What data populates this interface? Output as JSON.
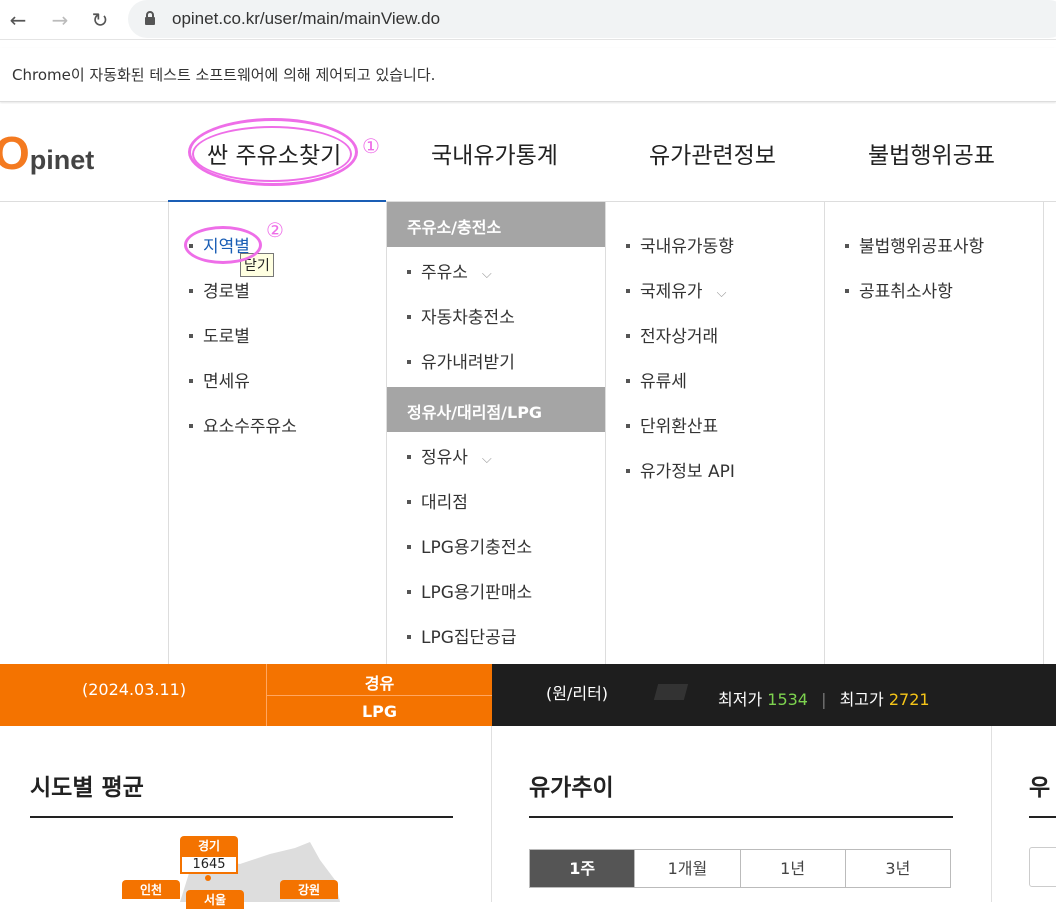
{
  "browser": {
    "url": "opinet.co.kr/user/main/mainView.do",
    "infobar_text": "Chrome이 자동화된 테스트 소프트웨어에 의해 제어되고 있습니다."
  },
  "header": {
    "logo_o": "O",
    "logo_rest": "pinet",
    "gnb": [
      "싼 주유소찾기",
      "국내유가통계",
      "유가관련정보",
      "불법행위공표"
    ]
  },
  "mega_menu": {
    "col1": [
      "지역별",
      "경로별",
      "도로별",
      "면세유",
      "요소수주유소"
    ],
    "col2_header1": "주유소/충전소",
    "col2_group1": [
      "주유소",
      "자동차충전소",
      "유가내려받기"
    ],
    "col2_header2": "정유사/대리점/LPG",
    "col2_group2": [
      "정유사",
      "대리점",
      "LPG용기충전소",
      "LPG용기판매소",
      "LPG집단공급"
    ],
    "col3": [
      "국내유가동향",
      "국제유가",
      "전자상거래",
      "유류세",
      "단위환산표",
      "유가정보 API"
    ],
    "col4": [
      "불법행위공표사항",
      "공표취소사항"
    ],
    "chevron": "⌵"
  },
  "tooltip": "닫기",
  "annotations": {
    "one": "①",
    "two": "②"
  },
  "band": {
    "date": "(2024.03.11)",
    "fuel1": "경유",
    "fuel2": "LPG",
    "unit": "(원/리터)",
    "low_label": "최저가",
    "low_value": "1534",
    "high_label": "최고가",
    "high_value": "2721",
    "separator": "|"
  },
  "sections": {
    "region_avg": "시도별 평균",
    "price_trend": "유가추이",
    "right_partial": "우"
  },
  "trend_tabs": [
    "1주",
    "1개월",
    "1년",
    "3년"
  ],
  "map": {
    "regions": [
      {
        "name": "경기",
        "value": "1645"
      },
      {
        "name": "인천",
        "value": ""
      },
      {
        "name": "서울",
        "value": ""
      },
      {
        "name": "강원",
        "value": ""
      }
    ]
  },
  "colors": {
    "accent": "#f47300",
    "nav_active": "#1a5eb5",
    "annotation": "#ee6ee8"
  }
}
